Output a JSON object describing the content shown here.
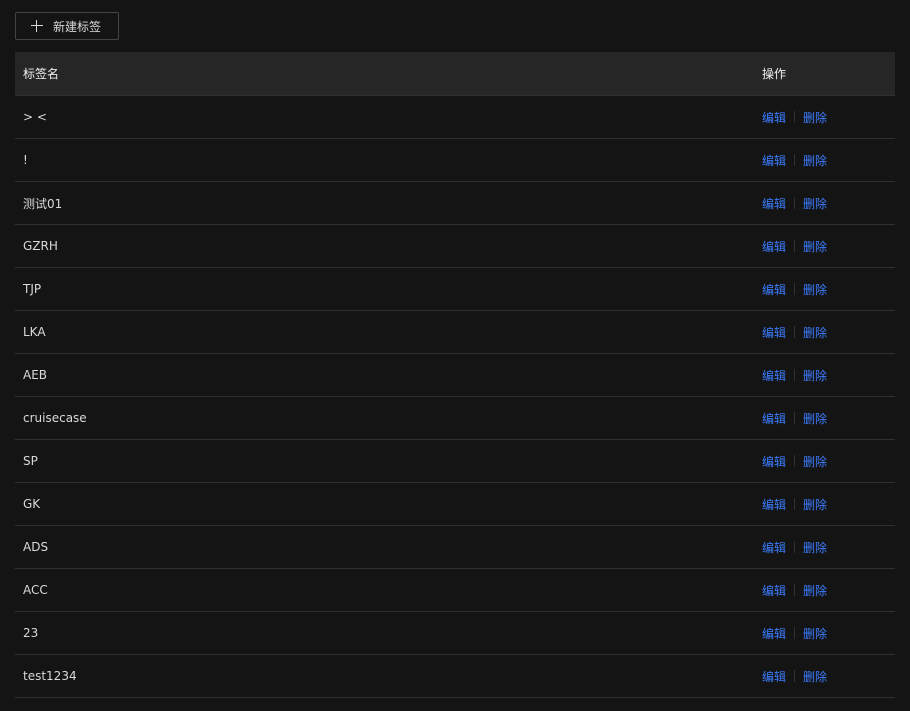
{
  "toolbar": {
    "new_tag_label": "新建标签",
    "new_tag_icon": "plus-icon"
  },
  "table": {
    "headers": {
      "name": "标签名",
      "actions": "操作"
    },
    "action_labels": {
      "edit": "编辑",
      "delete": "删除"
    },
    "rows": [
      {
        "name": "> <"
      },
      {
        "name": "!"
      },
      {
        "name": "测试01"
      },
      {
        "name": "GZRH"
      },
      {
        "name": "TJP"
      },
      {
        "name": "LKA"
      },
      {
        "name": "AEB"
      },
      {
        "name": "cruisecase"
      },
      {
        "name": "SP"
      },
      {
        "name": "GK"
      },
      {
        "name": "ADS"
      },
      {
        "name": "ACC"
      },
      {
        "name": "23"
      },
      {
        "name": "test1234"
      }
    ]
  },
  "colors": {
    "background": "#141414",
    "header_background": "#262626",
    "link": "#3b7cff",
    "border": "#303030"
  }
}
